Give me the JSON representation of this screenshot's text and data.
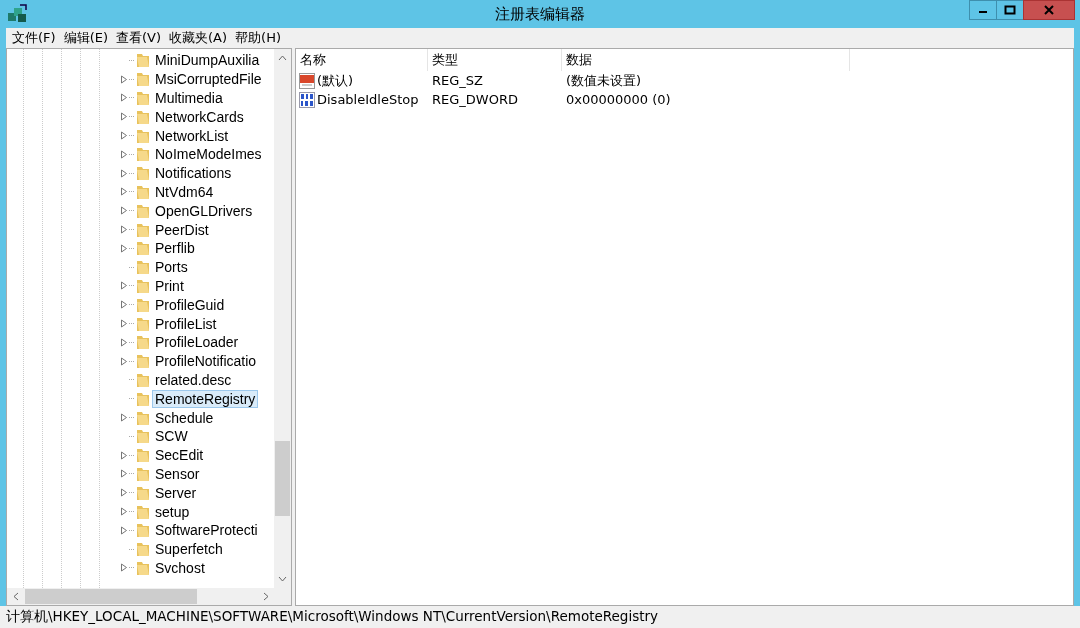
{
  "window": {
    "title": "注册表编辑器"
  },
  "menu": [
    "文件(F)",
    "编辑(E)",
    "查看(V)",
    "收藏夹(A)",
    "帮助(H)"
  ],
  "tree": [
    {
      "name": "MiniDumpAuxilia",
      "expandable": false,
      "selected": false
    },
    {
      "name": "MsiCorruptedFile",
      "expandable": true,
      "selected": false
    },
    {
      "name": "Multimedia",
      "expandable": true,
      "selected": false
    },
    {
      "name": "NetworkCards",
      "expandable": true,
      "selected": false
    },
    {
      "name": "NetworkList",
      "expandable": true,
      "selected": false
    },
    {
      "name": "NoImeModeImes",
      "expandable": true,
      "selected": false
    },
    {
      "name": "Notifications",
      "expandable": true,
      "selected": false
    },
    {
      "name": "NtVdm64",
      "expandable": true,
      "selected": false
    },
    {
      "name": "OpenGLDrivers",
      "expandable": true,
      "selected": false
    },
    {
      "name": "PeerDist",
      "expandable": true,
      "selected": false
    },
    {
      "name": "Perflib",
      "expandable": true,
      "selected": false
    },
    {
      "name": "Ports",
      "expandable": false,
      "selected": false
    },
    {
      "name": "Print",
      "expandable": true,
      "selected": false
    },
    {
      "name": "ProfileGuid",
      "expandable": true,
      "selected": false
    },
    {
      "name": "ProfileList",
      "expandable": true,
      "selected": false
    },
    {
      "name": "ProfileLoader",
      "expandable": true,
      "selected": false
    },
    {
      "name": "ProfileNotificatio",
      "expandable": true,
      "selected": false
    },
    {
      "name": "related.desc",
      "expandable": false,
      "selected": false
    },
    {
      "name": "RemoteRegistry",
      "expandable": false,
      "selected": true
    },
    {
      "name": "Schedule",
      "expandable": true,
      "selected": false
    },
    {
      "name": "SCW",
      "expandable": false,
      "selected": false
    },
    {
      "name": "SecEdit",
      "expandable": true,
      "selected": false
    },
    {
      "name": "Sensor",
      "expandable": true,
      "selected": false
    },
    {
      "name": "Server",
      "expandable": true,
      "selected": false
    },
    {
      "name": "setup",
      "expandable": true,
      "selected": false
    },
    {
      "name": "SoftwareProtecti",
      "expandable": true,
      "selected": false
    },
    {
      "name": "Superfetch",
      "expandable": false,
      "selected": false
    },
    {
      "name": "Svchost",
      "expandable": true,
      "selected": false
    }
  ],
  "values_table": {
    "columns": [
      "名称",
      "类型",
      "数据"
    ],
    "rows": [
      {
        "kind": "string",
        "name": "(默认)",
        "type": "REG_SZ",
        "data": "(数值未设置)"
      },
      {
        "kind": "binary",
        "name": "DisableIdleStop",
        "type": "REG_DWORD",
        "data": "0x00000000 (0)"
      }
    ]
  },
  "status_bar": "计算机\\HKEY_LOCAL_MACHINE\\SOFTWARE\\Microsoft\\Windows NT\\CurrentVersion\\RemoteRegistry"
}
